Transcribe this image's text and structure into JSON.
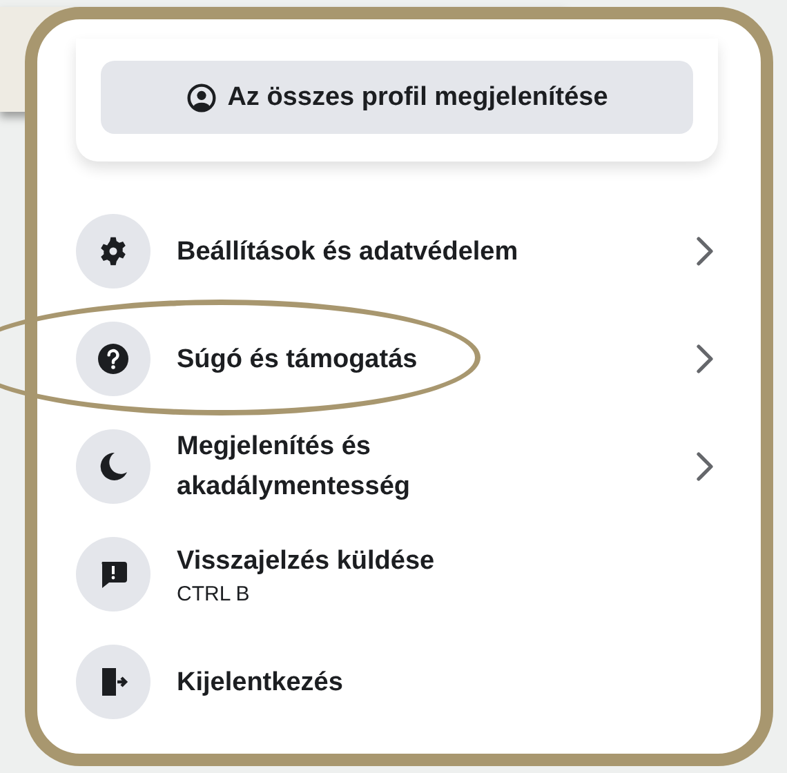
{
  "profile_button": {
    "label": "Az összes profil megjelenítése"
  },
  "menu": [
    {
      "label": "Beállítások és adatvédelem",
      "has_submenu": true,
      "highlighted": false
    },
    {
      "label": "Súgó és támogatás",
      "has_submenu": true,
      "highlighted": true
    },
    {
      "label": "Megjelenítés és\nakadálymentesség",
      "has_submenu": true,
      "highlighted": false
    },
    {
      "label": "Visszajelzés küldése",
      "shortcut": "CTRL B",
      "has_submenu": false,
      "highlighted": false
    },
    {
      "label": "Kijelentkezés",
      "has_submenu": false,
      "highlighted": false
    }
  ]
}
